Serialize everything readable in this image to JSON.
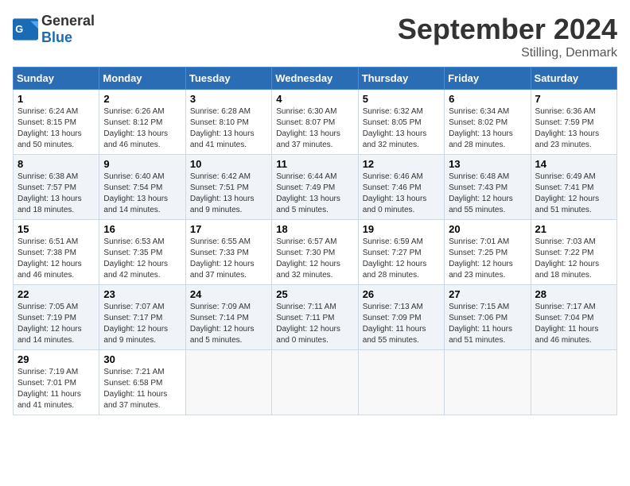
{
  "header": {
    "logo_general": "General",
    "logo_blue": "Blue",
    "month_title": "September 2024",
    "location": "Stilling, Denmark"
  },
  "days_of_week": [
    "Sunday",
    "Monday",
    "Tuesday",
    "Wednesday",
    "Thursday",
    "Friday",
    "Saturday"
  ],
  "weeks": [
    [
      {
        "day": "1",
        "sunrise": "6:24 AM",
        "sunset": "8:15 PM",
        "daylight": "13 hours and 50 minutes."
      },
      {
        "day": "2",
        "sunrise": "6:26 AM",
        "sunset": "8:12 PM",
        "daylight": "13 hours and 46 minutes."
      },
      {
        "day": "3",
        "sunrise": "6:28 AM",
        "sunset": "8:10 PM",
        "daylight": "13 hours and 41 minutes."
      },
      {
        "day": "4",
        "sunrise": "6:30 AM",
        "sunset": "8:07 PM",
        "daylight": "13 hours and 37 minutes."
      },
      {
        "day": "5",
        "sunrise": "6:32 AM",
        "sunset": "8:05 PM",
        "daylight": "13 hours and 32 minutes."
      },
      {
        "day": "6",
        "sunrise": "6:34 AM",
        "sunset": "8:02 PM",
        "daylight": "13 hours and 28 minutes."
      },
      {
        "day": "7",
        "sunrise": "6:36 AM",
        "sunset": "7:59 PM",
        "daylight": "13 hours and 23 minutes."
      }
    ],
    [
      {
        "day": "8",
        "sunrise": "6:38 AM",
        "sunset": "7:57 PM",
        "daylight": "13 hours and 18 minutes."
      },
      {
        "day": "9",
        "sunrise": "6:40 AM",
        "sunset": "7:54 PM",
        "daylight": "13 hours and 14 minutes."
      },
      {
        "day": "10",
        "sunrise": "6:42 AM",
        "sunset": "7:51 PM",
        "daylight": "13 hours and 9 minutes."
      },
      {
        "day": "11",
        "sunrise": "6:44 AM",
        "sunset": "7:49 PM",
        "daylight": "13 hours and 5 minutes."
      },
      {
        "day": "12",
        "sunrise": "6:46 AM",
        "sunset": "7:46 PM",
        "daylight": "13 hours and 0 minutes."
      },
      {
        "day": "13",
        "sunrise": "6:48 AM",
        "sunset": "7:43 PM",
        "daylight": "12 hours and 55 minutes."
      },
      {
        "day": "14",
        "sunrise": "6:49 AM",
        "sunset": "7:41 PM",
        "daylight": "12 hours and 51 minutes."
      }
    ],
    [
      {
        "day": "15",
        "sunrise": "6:51 AM",
        "sunset": "7:38 PM",
        "daylight": "12 hours and 46 minutes."
      },
      {
        "day": "16",
        "sunrise": "6:53 AM",
        "sunset": "7:35 PM",
        "daylight": "12 hours and 42 minutes."
      },
      {
        "day": "17",
        "sunrise": "6:55 AM",
        "sunset": "7:33 PM",
        "daylight": "12 hours and 37 minutes."
      },
      {
        "day": "18",
        "sunrise": "6:57 AM",
        "sunset": "7:30 PM",
        "daylight": "12 hours and 32 minutes."
      },
      {
        "day": "19",
        "sunrise": "6:59 AM",
        "sunset": "7:27 PM",
        "daylight": "12 hours and 28 minutes."
      },
      {
        "day": "20",
        "sunrise": "7:01 AM",
        "sunset": "7:25 PM",
        "daylight": "12 hours and 23 minutes."
      },
      {
        "day": "21",
        "sunrise": "7:03 AM",
        "sunset": "7:22 PM",
        "daylight": "12 hours and 18 minutes."
      }
    ],
    [
      {
        "day": "22",
        "sunrise": "7:05 AM",
        "sunset": "7:19 PM",
        "daylight": "12 hours and 14 minutes."
      },
      {
        "day": "23",
        "sunrise": "7:07 AM",
        "sunset": "7:17 PM",
        "daylight": "12 hours and 9 minutes."
      },
      {
        "day": "24",
        "sunrise": "7:09 AM",
        "sunset": "7:14 PM",
        "daylight": "12 hours and 5 minutes."
      },
      {
        "day": "25",
        "sunrise": "7:11 AM",
        "sunset": "7:11 PM",
        "daylight": "12 hours and 0 minutes."
      },
      {
        "day": "26",
        "sunrise": "7:13 AM",
        "sunset": "7:09 PM",
        "daylight": "11 hours and 55 minutes."
      },
      {
        "day": "27",
        "sunrise": "7:15 AM",
        "sunset": "7:06 PM",
        "daylight": "11 hours and 51 minutes."
      },
      {
        "day": "28",
        "sunrise": "7:17 AM",
        "sunset": "7:04 PM",
        "daylight": "11 hours and 46 minutes."
      }
    ],
    [
      {
        "day": "29",
        "sunrise": "7:19 AM",
        "sunset": "7:01 PM",
        "daylight": "11 hours and 41 minutes."
      },
      {
        "day": "30",
        "sunrise": "7:21 AM",
        "sunset": "6:58 PM",
        "daylight": "11 hours and 37 minutes."
      },
      null,
      null,
      null,
      null,
      null
    ]
  ]
}
